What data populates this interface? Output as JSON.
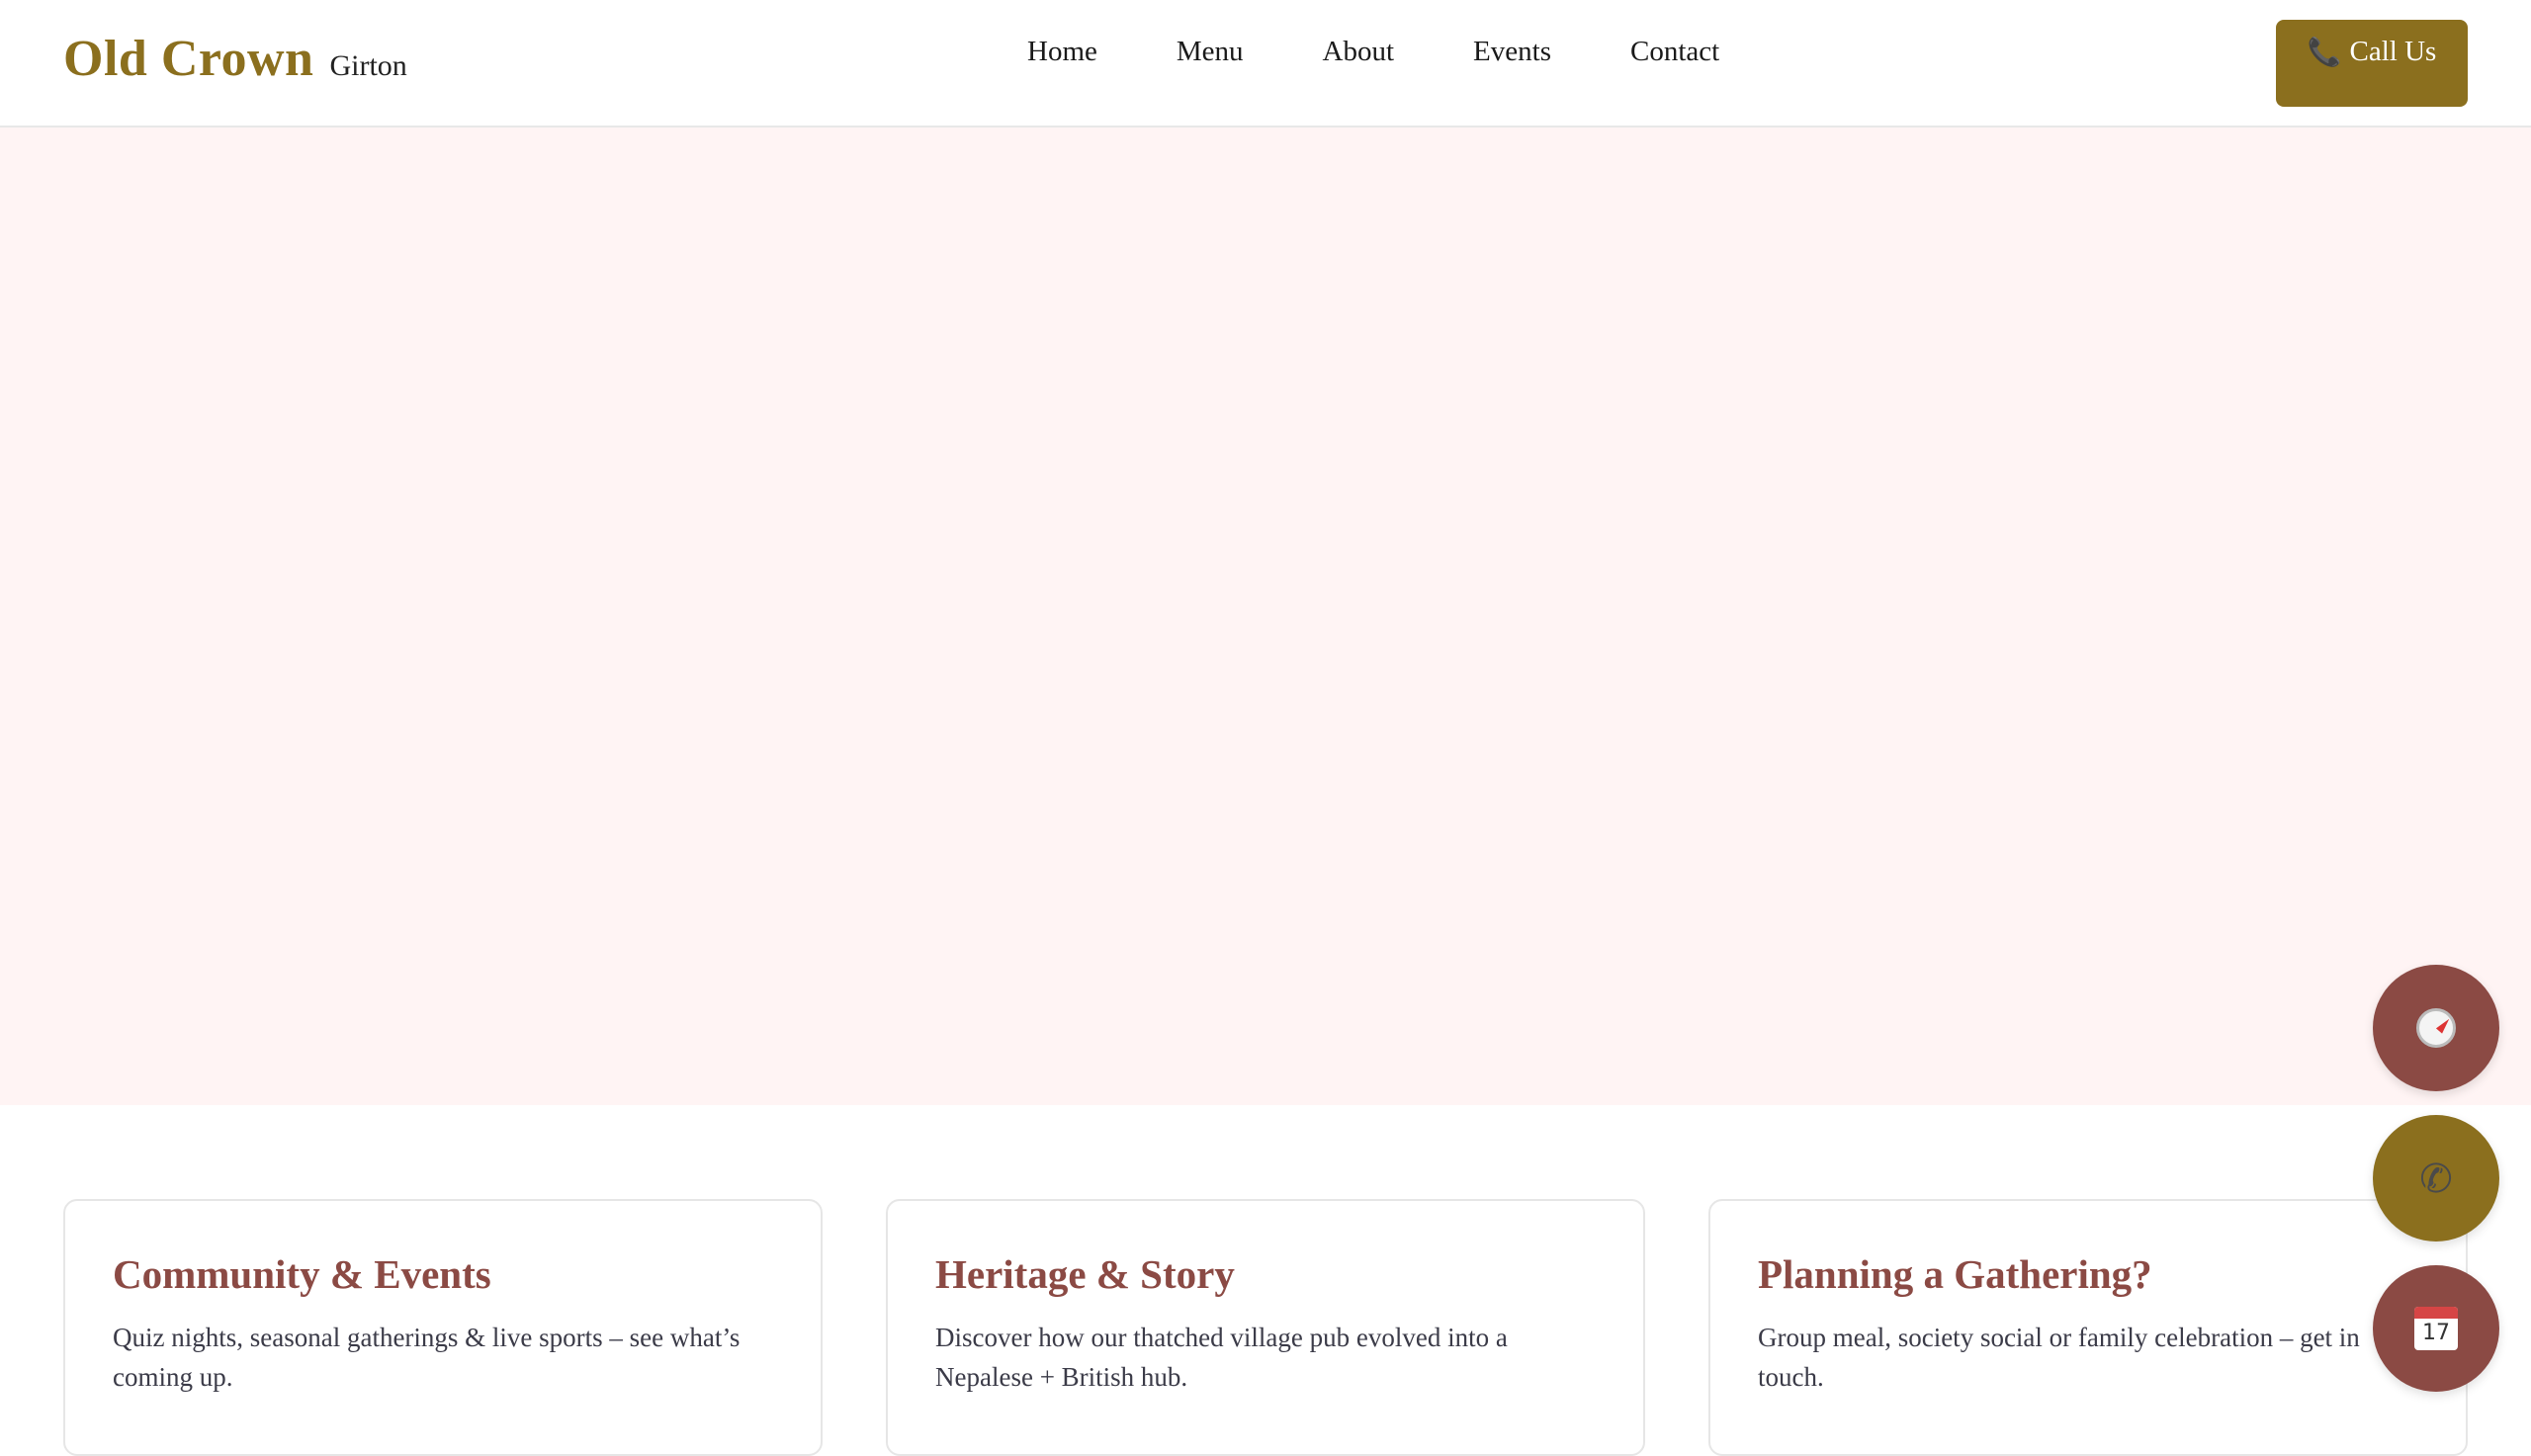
{
  "header": {
    "brand_name": "Old Crown",
    "brand_location": "Girton",
    "nav": [
      "Home",
      "Menu",
      "About",
      "Events",
      "Contact"
    ],
    "call_label": "Call Us",
    "call_icon": "phone-icon"
  },
  "cards": [
    {
      "title": "Community & Events",
      "text": "Quiz nights, seasonal gatherings & live sports – see what’s coming up."
    },
    {
      "title": "Heritage & Story",
      "text": "Discover how our thatched village pub evolved into a Nepalese + British hub."
    },
    {
      "title": "Planning a Gathering?",
      "text": "Group meal, society social or family celebration – get in touch."
    }
  ],
  "fabs": {
    "compass_icon": "compass-icon",
    "phone_icon": "phone-icon",
    "calendar_icon": "calendar-icon",
    "calendar_day": "17"
  },
  "colors": {
    "brand_gold": "#8b6f1e",
    "accent_maroon": "#8b4a44",
    "hero_bg": "#fff4f4"
  }
}
